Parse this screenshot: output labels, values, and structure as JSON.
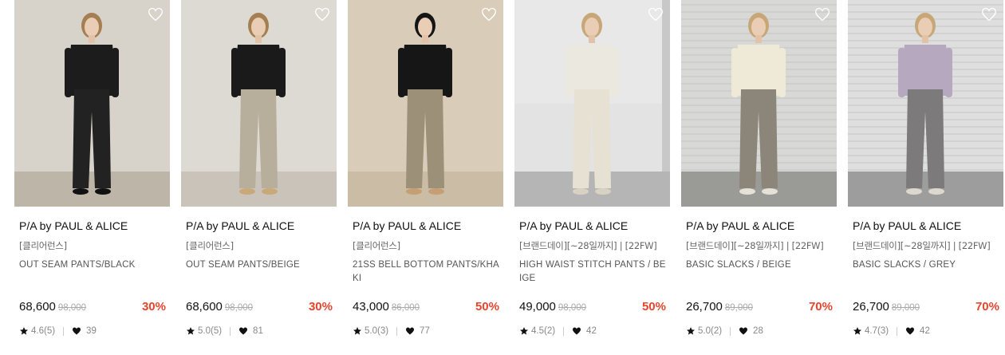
{
  "products": [
    {
      "brand": "P/A by PAUL & ALICE",
      "tag": "[클리어런스]",
      "name": "OUT SEAM PANTS/BLACK",
      "price": "68,600",
      "original_price": "98,000",
      "discount": "30%",
      "rating": "4.6(5)",
      "likes": "39",
      "photo": {
        "bg": "#d7d2ca",
        "floor": "#bdb5a8",
        "top_color": "#1c1c1c",
        "pants_color": "#222222",
        "hair": "#a57f52",
        "shoes": "#111111"
      }
    },
    {
      "brand": "P/A by PAUL & ALICE",
      "tag": "[클리어런스]",
      "name": "OUT SEAM PANTS/BEIGE",
      "price": "68,600",
      "original_price": "98,000",
      "discount": "30%",
      "rating": "5.0(5)",
      "likes": "81",
      "photo": {
        "bg": "#ddd9d3",
        "floor": "#c9c3b9",
        "top_color": "#1a1a1a",
        "pants_color": "#b7ae9b",
        "hair": "#a57f52",
        "shoes": "#c9a97a"
      }
    },
    {
      "brand": "P/A by PAUL & ALICE",
      "tag": "[클리어런스]",
      "name": "21SS BELL BOTTOM PANTS/KHAKI",
      "price": "43,000",
      "original_price": "86,000",
      "discount": "50%",
      "rating": "5.0(3)",
      "likes": "77",
      "photo": {
        "bg": "#d9cdb9",
        "floor": "#cbbda5",
        "top_color": "#161616",
        "pants_color": "#9c9079",
        "hair": "#151515",
        "shoes": "#c59f73"
      }
    },
    {
      "brand": "P/A by PAUL & ALICE",
      "tag": "[브랜드데이][~28일까지] | [22FW]",
      "name": "HIGH WAIST STITCH PANTS / BEIGE",
      "price": "49,000",
      "original_price": "98,000",
      "discount": "50%",
      "rating": "4.5(2)",
      "likes": "42",
      "photo": {
        "bg": "#e3e3e3",
        "floor": "#b5b5b5",
        "top_color": "#ebe8df",
        "pants_color": "#e6e1d3",
        "hair": "#c7a777",
        "shoes": "#d8d2c2"
      }
    },
    {
      "brand": "P/A by PAUL & ALICE",
      "tag": "[브랜드데이][~28일까지] | [22FW]",
      "name": "BASIC SLACKS / BEIGE",
      "price": "26,700",
      "original_price": "89,000",
      "discount": "70%",
      "rating": "5.0(2)",
      "likes": "28",
      "photo": {
        "bg": "#d8d8d6",
        "floor": "#9a9a96",
        "top_color": "#efe9d8",
        "pants_color": "#8c8579",
        "hair": "#c7a777",
        "shoes": "#e6e1d6"
      }
    },
    {
      "brand": "P/A by PAUL & ALICE",
      "tag": "[브랜드데이][~28일까지] | [22FW]",
      "name": "BASIC SLACKS / GREY",
      "price": "26,700",
      "original_price": "89,000",
      "discount": "70%",
      "rating": "4.7(3)",
      "likes": "42",
      "photo": {
        "bg": "#dedede",
        "floor": "#9d9d9d",
        "top_color": "#b6a9bf",
        "pants_color": "#7c7a7a",
        "hair": "#c7a777",
        "shoes": "#dcd8cf"
      }
    }
  ],
  "icons": {
    "wish": "heart-outline-icon",
    "rating": "star-icon",
    "likes": "heart-filled-icon"
  }
}
